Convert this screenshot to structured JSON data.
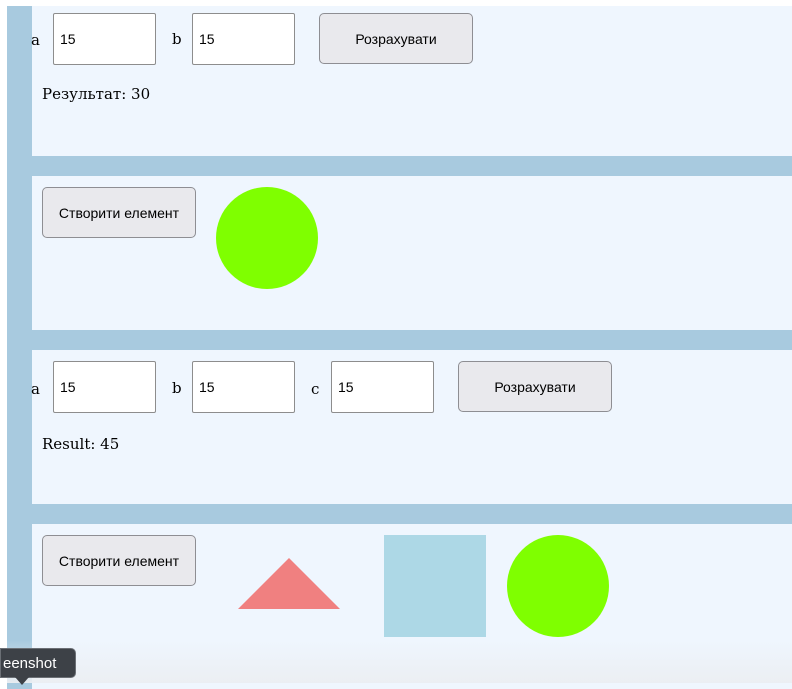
{
  "sum2": {
    "label_a": "a",
    "value_a": "15",
    "label_b": "b",
    "value_b": "15",
    "button_label": "Розрахувати",
    "result_text": "Результат: 30"
  },
  "create1": {
    "button_label": "Створити елемент",
    "shapes": [
      {
        "type": "circle",
        "color": "#7fff00"
      }
    ]
  },
  "sum3": {
    "label_a": "a",
    "value_a": "15",
    "label_b": "b",
    "value_b": "15",
    "label_c": "c",
    "value_c": "15",
    "button_label": "Розрахувати",
    "result_text": "Result: 45"
  },
  "create2": {
    "button_label": "Створити елемент",
    "shapes": [
      {
        "type": "triangle",
        "color": "#f08080"
      },
      {
        "type": "square",
        "color": "#add8e6"
      },
      {
        "type": "circle",
        "color": "#7fff00"
      }
    ]
  },
  "tooltip": {
    "text": "eenshot"
  },
  "colors": {
    "frame": "#a8cadf",
    "panel": "#eff6fe",
    "button": "#e9e9ed"
  }
}
